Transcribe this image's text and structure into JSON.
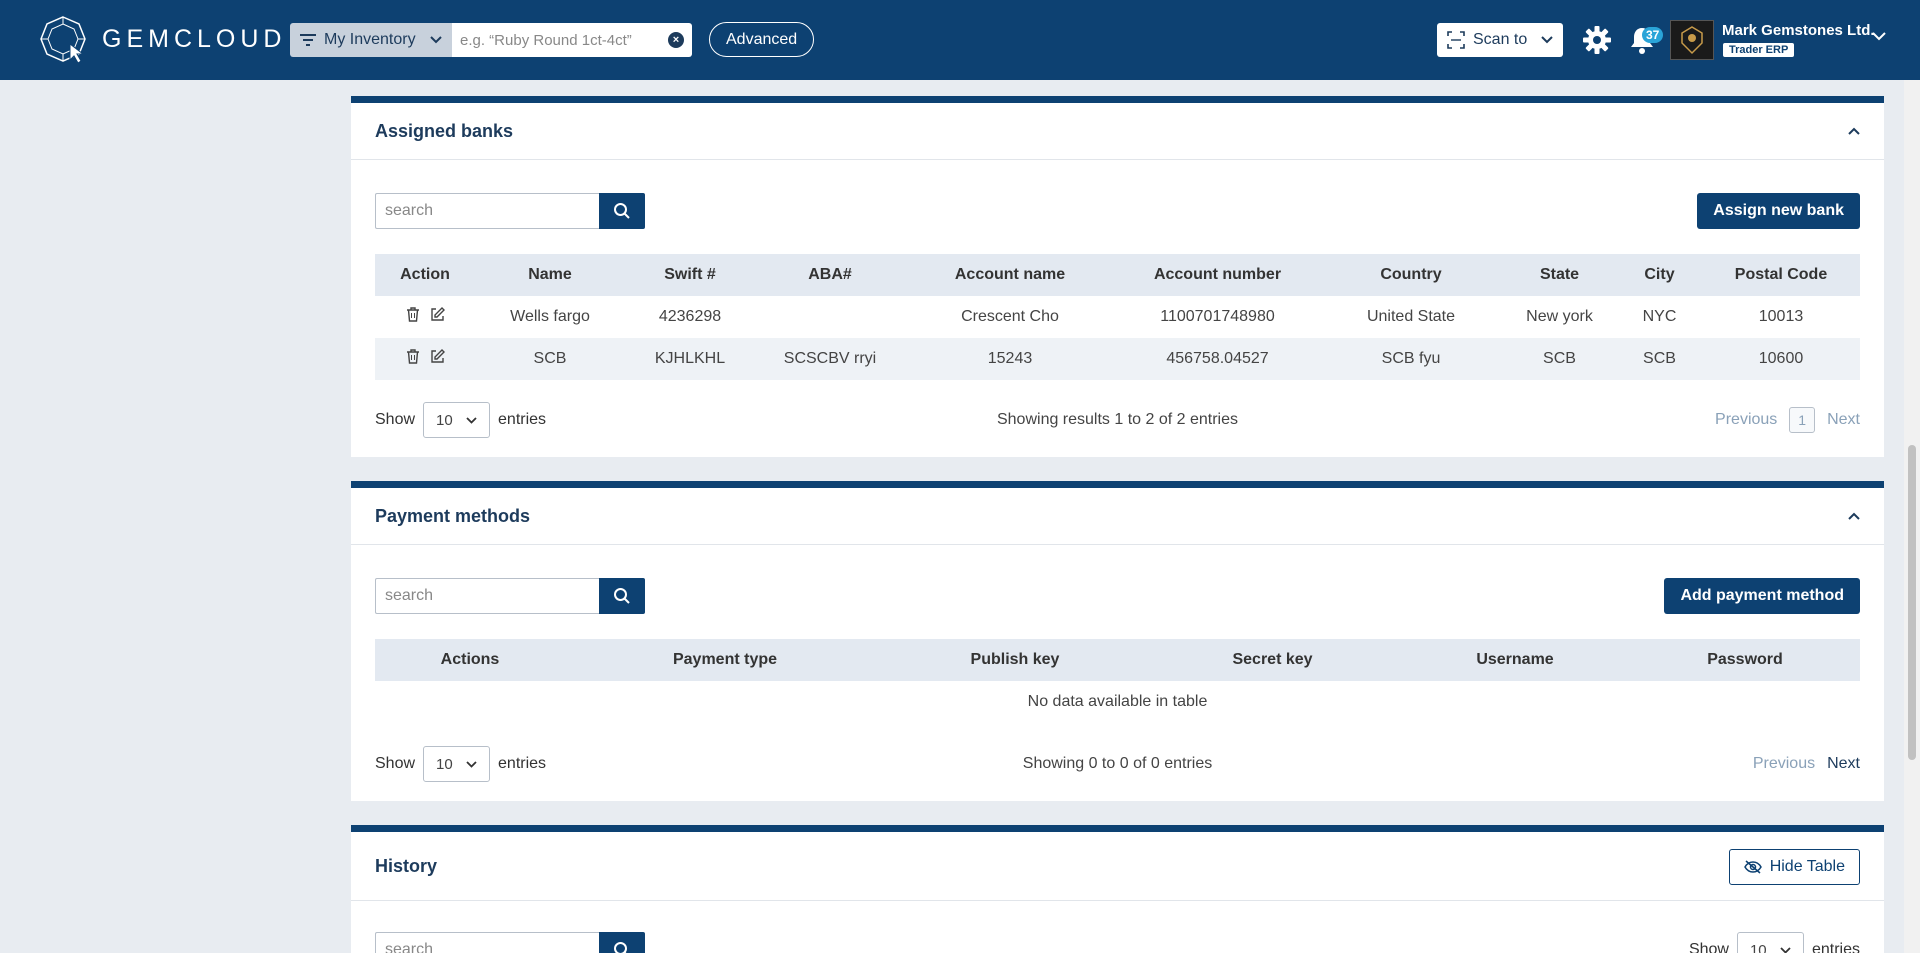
{
  "header": {
    "brand": "GEMCLOUD",
    "scope": "My Inventory",
    "search_placeholder": "e.g. “Ruby Round 1ct-4ct”",
    "advanced_label": "Advanced",
    "scan_label": "Scan to",
    "notification_count": "37",
    "company_name": "Mark Gemstones Ltd.",
    "role": "Trader ERP",
    "brand_color": "#0d4172"
  },
  "banks": {
    "title": "Assigned banks",
    "search_placeholder": "search",
    "assign_label": "Assign new bank",
    "columns": [
      "Action",
      "Name",
      "Swift #",
      "ABA#",
      "Account name",
      "Account number",
      "Country",
      "State",
      "City",
      "Postal Code"
    ],
    "rows": [
      {
        "name": "Wells fargo",
        "swift": "4236298",
        "aba": "",
        "account_name": "Crescent Cho",
        "account_number": "1100701748980",
        "country": "United State",
        "state": "New york",
        "city": "NYC",
        "postal": "10013"
      },
      {
        "name": "SCB",
        "swift": "KJHLKHL",
        "aba": "SCSCBV rryi",
        "account_name": "15243",
        "account_number": "456758.04527",
        "country": "SCB fyu",
        "state": "SCB",
        "city": "SCB",
        "postal": "10600"
      }
    ],
    "show_label": "Show",
    "entries_label": "entries",
    "page_length": "10",
    "info": "Showing results 1 to 2 of 2 entries",
    "prev_label": "Previous",
    "page": "1",
    "next_label": "Next"
  },
  "payments": {
    "title": "Payment methods",
    "search_placeholder": "search",
    "add_label": "Add payment method",
    "columns": [
      "Actions",
      "Payment type",
      "Publish key",
      "Secret key",
      "Username",
      "Password"
    ],
    "empty": "No data available in table",
    "show_label": "Show",
    "entries_label": "entries",
    "page_length": "10",
    "info": "Showing 0 to 0 of 0 entries",
    "prev_label": "Previous",
    "next_label": "Next"
  },
  "history": {
    "title": "History",
    "hide_label": "Hide Table",
    "search_placeholder": "search",
    "show_label": "Show",
    "page_length": "10",
    "entries_label": "entries"
  }
}
